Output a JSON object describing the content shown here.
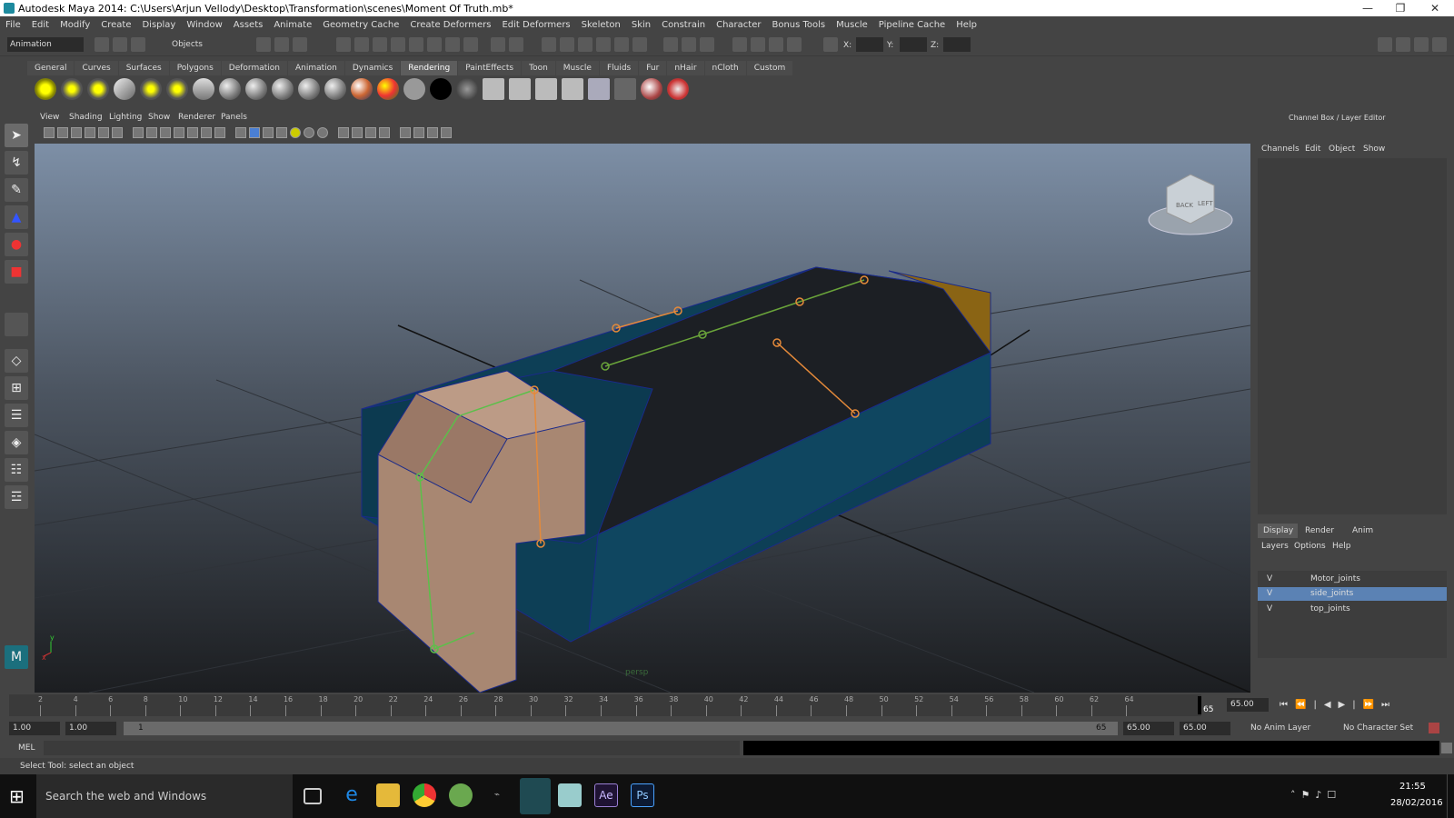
{
  "window": {
    "title": "Autodesk Maya 2014: C:\\Users\\Arjun Vellody\\Desktop\\Transformation\\scenes\\Moment Of Truth.mb*",
    "minimize": "—",
    "restore": "❐",
    "close": "✕"
  },
  "menubar": [
    "File",
    "Edit",
    "Modify",
    "Create",
    "Display",
    "Window",
    "Assets",
    "Animate",
    "Geometry Cache",
    "Create Deformers",
    "Edit Deformers",
    "Skeleton",
    "Skin",
    "Constrain",
    "Character",
    "Bonus Tools",
    "Muscle",
    "Pipeline Cache",
    "Help"
  ],
  "statusline": {
    "menuset": "Animation",
    "selection_mode": "Objects",
    "x_label": "X:",
    "y_label": "Y:",
    "z_label": "Z:"
  },
  "shelf": {
    "tabs": [
      "General",
      "Curves",
      "Surfaces",
      "Polygons",
      "Deformation",
      "Animation",
      "Dynamics",
      "Rendering",
      "PaintEffects",
      "Toon",
      "Muscle",
      "Fluids",
      "Fur",
      "nHair",
      "nCloth",
      "Custom"
    ],
    "active_tab": "Rendering"
  },
  "panel_menu": [
    "View",
    "Shading",
    "Lighting",
    "Show",
    "Renderer",
    "Panels"
  ],
  "viewport": {
    "camera_label": "persp",
    "viewcube_labels": [
      "BACK",
      "LEFT"
    ],
    "axis_x": "x",
    "axis_y": "y"
  },
  "channel_box": {
    "title": "Channel Box / Layer Editor",
    "menus": [
      "Channels",
      "Edit",
      "Object",
      "Show"
    ]
  },
  "layer_editor": {
    "tabs": [
      "Display",
      "Render",
      "Anim"
    ],
    "active_tab": "Display",
    "menus": [
      "Layers",
      "Options",
      "Help"
    ],
    "layers": [
      {
        "visible": "V",
        "name": "Motor_joints",
        "selected": false
      },
      {
        "visible": "V",
        "name": "side_joints",
        "selected": true
      },
      {
        "visible": "V",
        "name": "top_joints",
        "selected": false
      }
    ]
  },
  "timeline": {
    "ticks": [
      "2",
      "4",
      "6",
      "8",
      "10",
      "12",
      "14",
      "16",
      "18",
      "20",
      "22",
      "24",
      "26",
      "28",
      "30",
      "32",
      "34",
      "36",
      "38",
      "40",
      "42",
      "44",
      "46",
      "48",
      "50",
      "52",
      "54",
      "56",
      "58",
      "60",
      "62",
      "64"
    ],
    "current_frame_marker": "65",
    "current_time": "65.00"
  },
  "range": {
    "start": "1.00",
    "playback_start": "1.00",
    "slider_start": "1",
    "slider_end": "65",
    "playback_end": "65.00",
    "end": "65.00",
    "anim_layer": "No Anim Layer",
    "character_set": "No Character Set"
  },
  "mel": {
    "label": "MEL"
  },
  "helpline": "Select Tool: select an object",
  "taskbar": {
    "search": "Search the web and Windows",
    "time": "21:55",
    "date": "28/02/2016",
    "ae_label": "Ae",
    "ps_label": "Ps"
  }
}
